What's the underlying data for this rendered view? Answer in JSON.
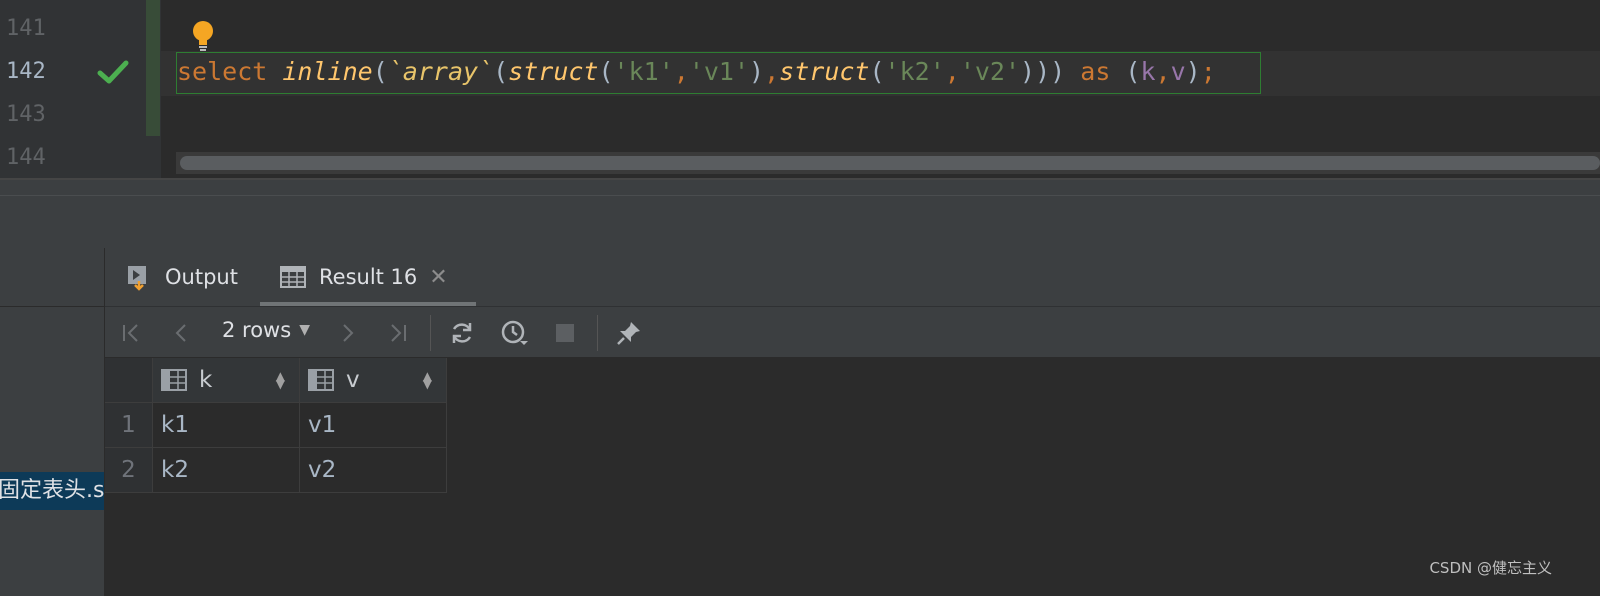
{
  "editor": {
    "line_numbers": [
      "141",
      "142",
      "143",
      "144"
    ],
    "code": {
      "select": "select",
      "inline": "inline",
      "paren_open": "(",
      "array": "`array`",
      "struct": "struct",
      "k1": "'k1'",
      "v1": "'v1'",
      "k2": "'k2'",
      "v2": "'v2'",
      "as": "as",
      "k": "k",
      "v": "v",
      "semi": ";"
    },
    "colors": {
      "keyword": "#cc7832",
      "function": "#ffc66d",
      "string": "#6a8759",
      "identifier": "#9876aa"
    }
  },
  "tabs": [
    {
      "label": "Output",
      "icon": "output-icon"
    },
    {
      "label": "Result 16",
      "icon": "table-icon",
      "active": true
    }
  ],
  "toolbar": {
    "rows_label": "2 rows",
    "icons": [
      "first-page-icon",
      "prev-page-icon",
      "next-page-icon",
      "last-page-icon",
      "refresh-icon",
      "history-icon",
      "stop-icon",
      "pin-icon"
    ]
  },
  "sidebar": {
    "file_label": "固定表头.s"
  },
  "grid": {
    "columns": [
      "k",
      "v"
    ],
    "rows": [
      {
        "num": "1",
        "k": "k1",
        "v": "v1"
      },
      {
        "num": "2",
        "k": "k2",
        "v": "v2"
      }
    ]
  },
  "watermark": "CSDN @健忘主义"
}
